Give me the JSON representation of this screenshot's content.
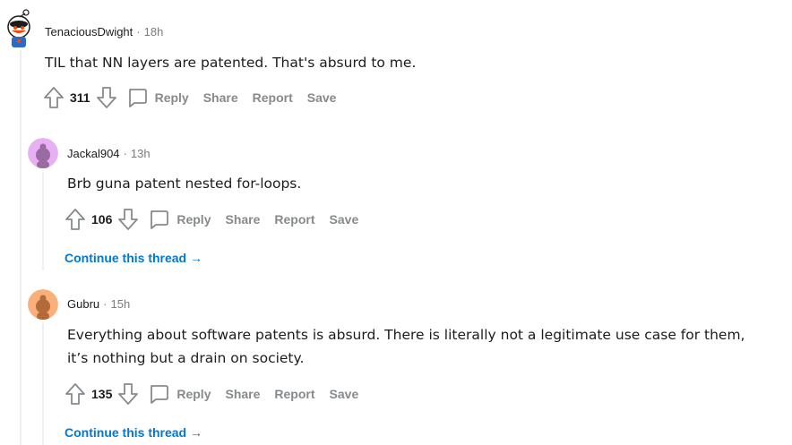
{
  "comments": [
    {
      "author": "TenaciousDwight",
      "time": "18h",
      "text": "TIL that NN layers are patented. That's absurd to me.",
      "score": "311",
      "avatar_color": "#ffffff"
    },
    {
      "author": "Jackal904",
      "time": "13h",
      "text": "Brb guna patent nested for-loops.",
      "score": "106",
      "avatar_color": "#e1a6f0",
      "continue": "Continue this thread →"
    },
    {
      "author": "Gubru",
      "time": "15h",
      "text_line1": "Everything about software patents is absurd. There is literally not a legitimate use case for them,",
      "text_line2": "it’s nothing but a drain on society.",
      "score": "135",
      "avatar_color": "#f7a86b",
      "continue": "Continue this thread →"
    }
  ],
  "actions": {
    "reply": "Reply",
    "share": "Share",
    "report": "Report",
    "save": "Save"
  },
  "separator": "·"
}
